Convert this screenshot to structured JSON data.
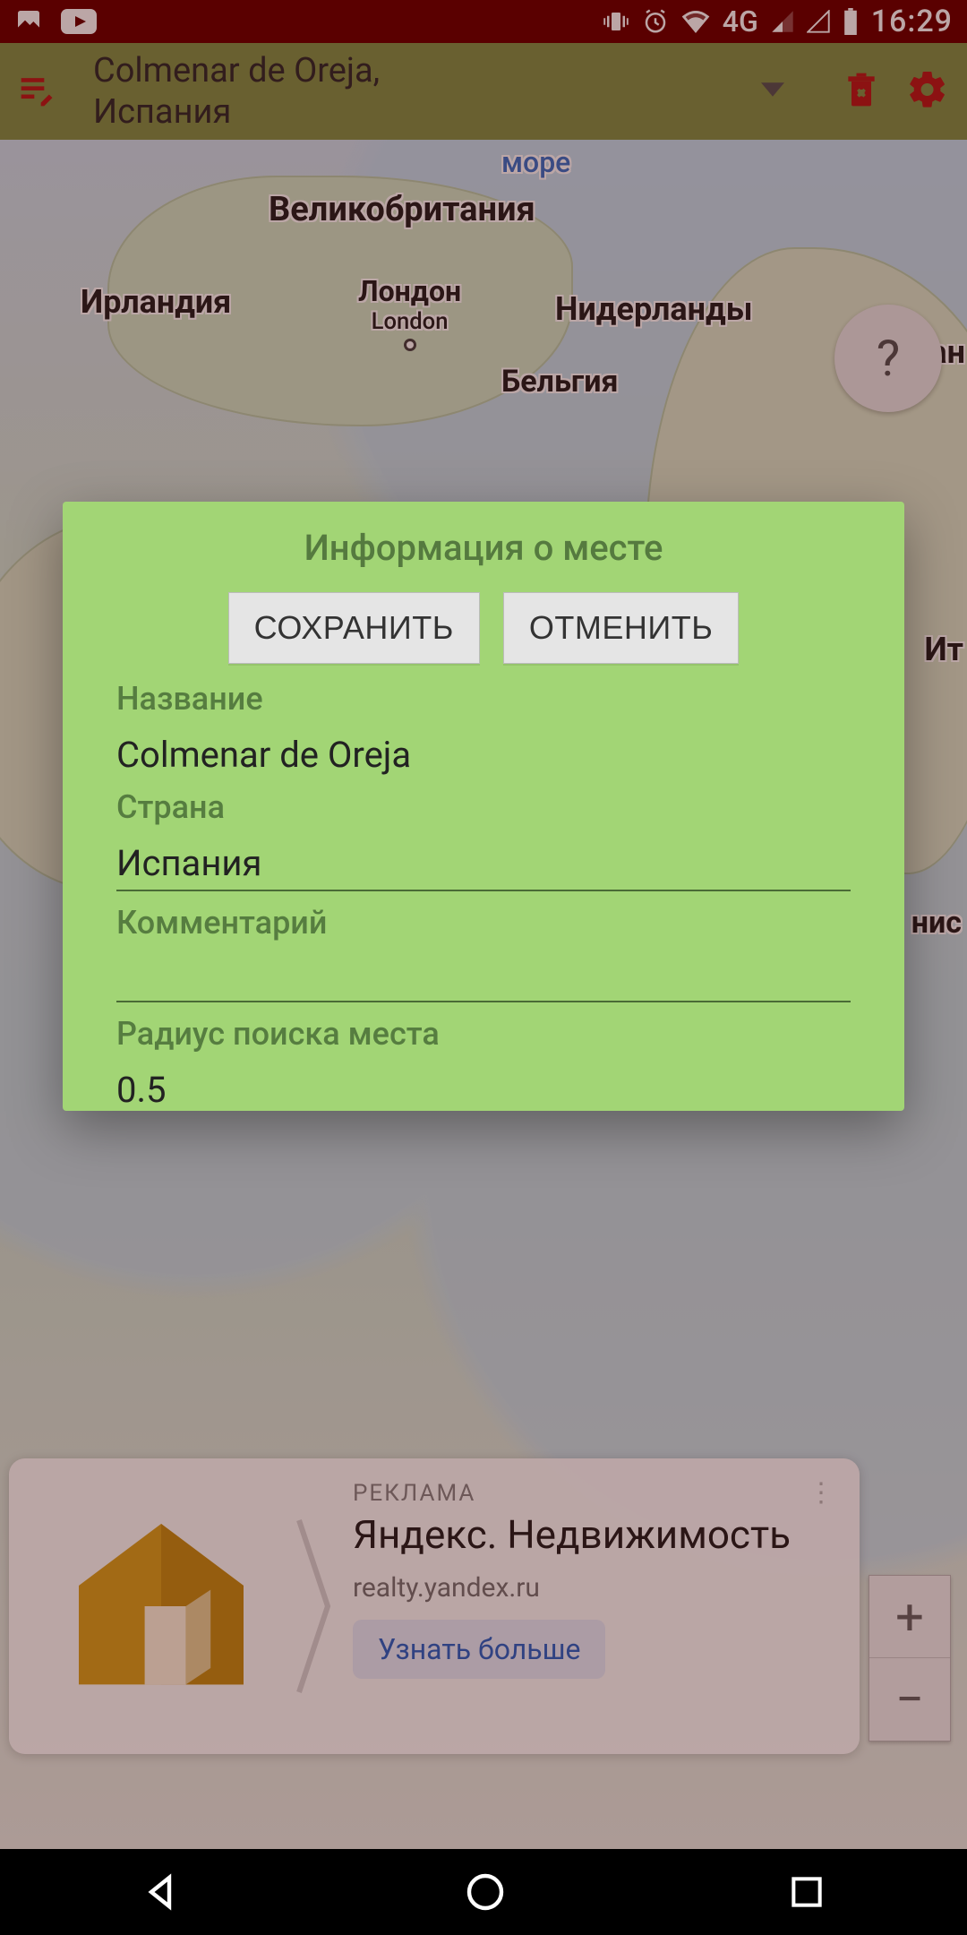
{
  "status": {
    "clock": "16:29",
    "network": "4G"
  },
  "appbar": {
    "title_line1": "Colmenar de Oreja,",
    "title_line2": "Испания"
  },
  "map_labels": {
    "sea": "море",
    "uk": "Великобритания",
    "ireland": "Ирландия",
    "london": "Лондон",
    "london_en": "London",
    "netherlands": "Нидерланды",
    "germany": "Герман",
    "belgium": "Бельгия",
    "it": "Ит",
    "nis": "нис"
  },
  "help": "?",
  "zoom": {
    "in": "+",
    "out": "−"
  },
  "ad": {
    "label": "РЕКЛАМА",
    "title": "Яндекс. Недвижи­мость",
    "subtitle": "realty.yandex.ru",
    "cta": "Узнать больше"
  },
  "dialog": {
    "title": "Информация о месте",
    "save": "СОХРАНИТЬ",
    "cancel": "ОТМЕНИТЬ",
    "name_label": "Название",
    "name_value": "Colmenar de Oreja",
    "country_label": "Страна",
    "country_value": "Испания",
    "comment_label": "Комментарий",
    "comment_value": "",
    "radius_label": "Радиус поиска места",
    "radius_value": "0.5"
  }
}
